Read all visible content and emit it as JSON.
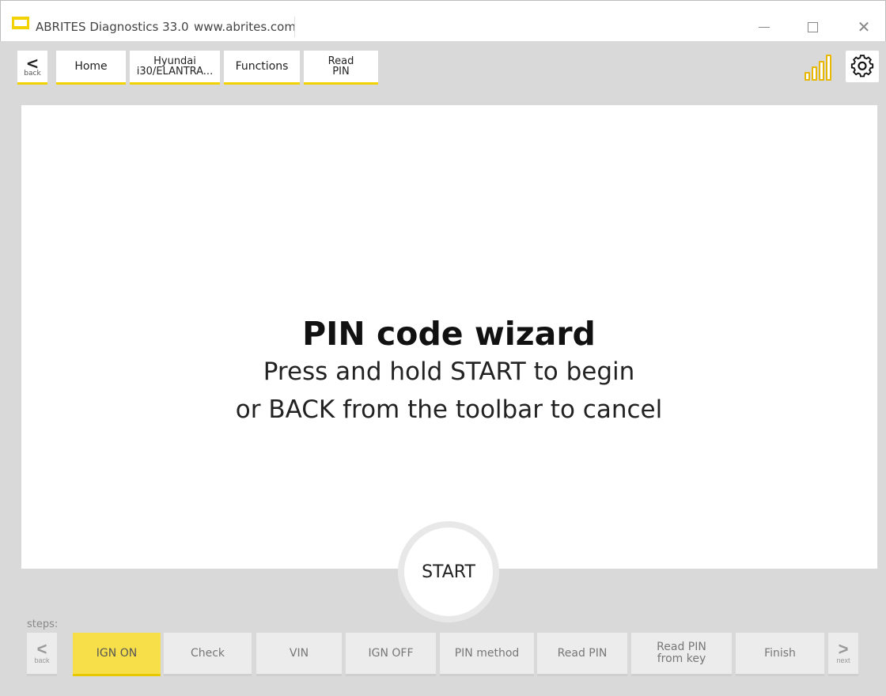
{
  "window": {
    "title": "ABRITES Diagnostics 33.0",
    "url": "www.abrites.com",
    "minimize_glyph": "—",
    "close_glyph": "✕"
  },
  "toolbar": {
    "back_glyph": "<",
    "back_label": "back",
    "home_label": "Home",
    "vehicle_line1": "Hyundai",
    "vehicle_line2": "i30/ELANTRA...",
    "functions_label": "Functions",
    "readpin_line1": "Read",
    "readpin_line2": "PIN",
    "signal_icon": "signal-bars-icon",
    "settings_icon": "gear-icon",
    "accent_color": "#f2d200"
  },
  "wizard": {
    "title": "PIN code wizard",
    "line1": "Press and hold START to begin",
    "line2": "or BACK from the toolbar to cancel",
    "start_label": "START"
  },
  "steps": {
    "label": "steps:",
    "back_glyph": "<",
    "back_label": "back",
    "next_glyph": ">",
    "next_label": "next",
    "items": [
      {
        "label": "IGN ON",
        "active": true
      },
      {
        "label": "Check",
        "active": false
      },
      {
        "label": "VIN",
        "active": false
      },
      {
        "label": "IGN OFF",
        "active": false
      },
      {
        "label": "PIN method",
        "active": false
      },
      {
        "label": "Read PIN",
        "active": false
      },
      {
        "label": "Read PIN from key",
        "active": false
      },
      {
        "label": "Finish",
        "active": false
      }
    ]
  }
}
